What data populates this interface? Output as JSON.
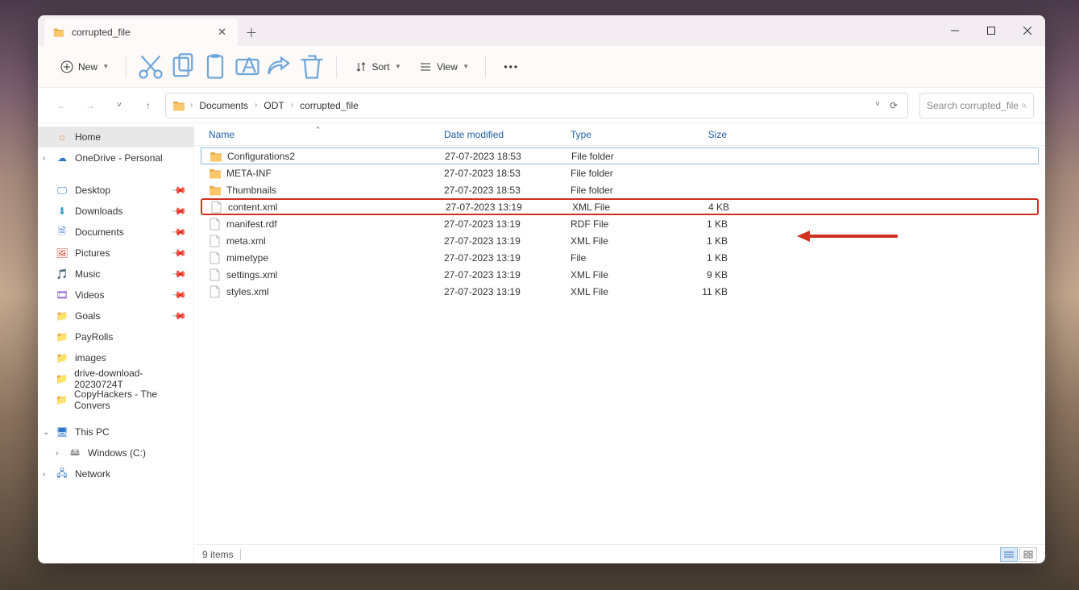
{
  "tab": {
    "title": "corrupted_file"
  },
  "toolbar": {
    "new_label": "New",
    "sort_label": "Sort",
    "view_label": "View"
  },
  "breadcrumb": {
    "items": [
      "Documents",
      "ODT",
      "corrupted_file"
    ]
  },
  "search": {
    "placeholder": "Search corrupted_file"
  },
  "sidebar": {
    "home": "Home",
    "onedrive": "OneDrive - Personal",
    "quick": [
      {
        "id": "desktop",
        "label": "Desktop",
        "pinned": true
      },
      {
        "id": "downloads",
        "label": "Downloads",
        "pinned": true
      },
      {
        "id": "documents",
        "label": "Documents",
        "pinned": true
      },
      {
        "id": "pictures",
        "label": "Pictures",
        "pinned": true
      },
      {
        "id": "music",
        "label": "Music",
        "pinned": true
      },
      {
        "id": "videos",
        "label": "Videos",
        "pinned": true
      },
      {
        "id": "goals",
        "label": "Goals",
        "pinned": true
      },
      {
        "id": "payrolls",
        "label": "PayRolls",
        "pinned": false
      },
      {
        "id": "images",
        "label": "images",
        "pinned": false
      },
      {
        "id": "drive-dl",
        "label": "drive-download-20230724T",
        "pinned": false
      },
      {
        "id": "copyhackers",
        "label": "CopyHackers - The Convers",
        "pinned": false
      }
    ],
    "thispc": "This PC",
    "windows_c": "Windows (C:)",
    "network": "Network"
  },
  "columns": {
    "name": "Name",
    "date": "Date modified",
    "type": "Type",
    "size": "Size"
  },
  "files": [
    {
      "name": "Configurations2",
      "date": "27-07-2023 18:53",
      "type": "File folder",
      "size": "",
      "icon": "folder"
    },
    {
      "name": "META-INF",
      "date": "27-07-2023 18:53",
      "type": "File folder",
      "size": "",
      "icon": "folder"
    },
    {
      "name": "Thumbnails",
      "date": "27-07-2023 18:53",
      "type": "File folder",
      "size": "",
      "icon": "folder"
    },
    {
      "name": "content.xml",
      "date": "27-07-2023 13:19",
      "type": "XML File",
      "size": "4 KB",
      "icon": "file"
    },
    {
      "name": "manifest.rdf",
      "date": "27-07-2023 13:19",
      "type": "RDF File",
      "size": "1 KB",
      "icon": "file"
    },
    {
      "name": "meta.xml",
      "date": "27-07-2023 13:19",
      "type": "XML File",
      "size": "1 KB",
      "icon": "file"
    },
    {
      "name": "mimetype",
      "date": "27-07-2023 13:19",
      "type": "File",
      "size": "1 KB",
      "icon": "file"
    },
    {
      "name": "settings.xml",
      "date": "27-07-2023 13:19",
      "type": "XML File",
      "size": "9 KB",
      "icon": "file"
    },
    {
      "name": "styles.xml",
      "date": "27-07-2023 13:19",
      "type": "XML File",
      "size": "11 KB",
      "icon": "file"
    }
  ],
  "selected_index": 0,
  "highlighted_index": 3,
  "status": {
    "text": "9 items"
  }
}
